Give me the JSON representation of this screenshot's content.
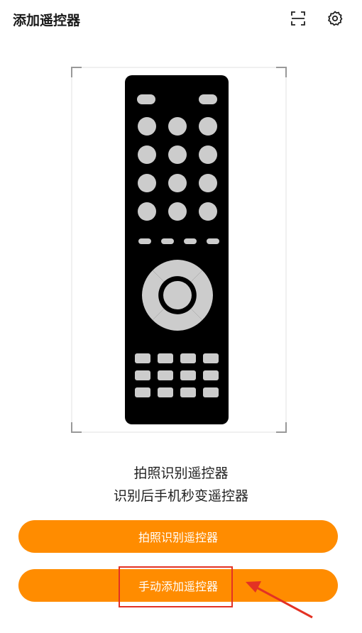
{
  "header": {
    "title": "添加遥控器",
    "scan_icon": "scan-icon",
    "settings_icon": "gear-icon"
  },
  "illustration": {
    "icon": "remote-control-icon",
    "frame_color": "#999999",
    "remote_color": "#000000",
    "button_color": "#cccccc"
  },
  "description": {
    "line1": "拍照识别遥控器",
    "line2": "识别后手机秒变遥控器"
  },
  "buttons": {
    "photo_label": "拍照识别遥控器",
    "manual_label": "手动添加遥控器",
    "color": "#ff8c00"
  },
  "annotation": {
    "highlight_color": "#e33224"
  }
}
